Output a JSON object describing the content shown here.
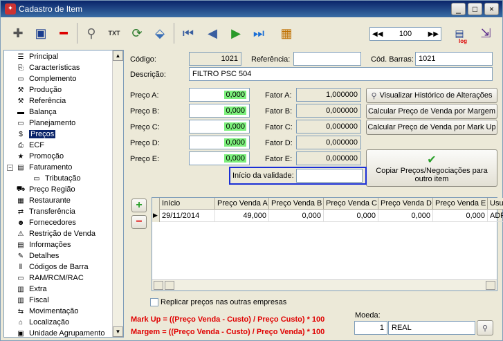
{
  "window": {
    "title": "Cadastro de Item",
    "minimize": "_",
    "maximize": "□",
    "close": "×"
  },
  "toolbar": {
    "nav_first": "◀◀",
    "nav_value": "100",
    "nav_last": "▶▶",
    "buttons": [
      {
        "name": "add-icon",
        "glyph": "✚"
      },
      {
        "name": "save-icon",
        "glyph": "💾"
      },
      {
        "name": "delete-icon",
        "glyph": "━"
      },
      {
        "name": "search-icon",
        "glyph": "🔍"
      },
      {
        "name": "txt-icon",
        "glyph": "TXT"
      },
      {
        "name": "refresh-icon",
        "glyph": "⟳"
      },
      {
        "name": "tag-icon",
        "glyph": "⎙"
      },
      {
        "name": "first-record-icon",
        "glyph": "⏮"
      },
      {
        "name": "prev-record-icon",
        "glyph": "◀"
      },
      {
        "name": "next-record-icon",
        "glyph": "▶"
      },
      {
        "name": "last-record-icon",
        "glyph": "⏭"
      },
      {
        "name": "calendar-icon",
        "glyph": "▦"
      }
    ],
    "log_label": "log"
  },
  "tree": [
    {
      "label": "Principal",
      "icon": "list-icon",
      "glyph": "☰",
      "indent": 1
    },
    {
      "label": "Características",
      "icon": "clip-icon",
      "glyph": "⎘",
      "indent": 1
    },
    {
      "label": "Complemento",
      "icon": "doc-icon",
      "glyph": "▭",
      "indent": 1
    },
    {
      "label": "Produção",
      "icon": "wrench-icon",
      "glyph": "⚒",
      "indent": 1
    },
    {
      "label": "Referência",
      "icon": "wrench-icon",
      "glyph": "⚒",
      "indent": 1
    },
    {
      "label": "Balança",
      "icon": "scale-icon",
      "glyph": "▬",
      "indent": 1
    },
    {
      "label": "Planejamento",
      "icon": "doc-icon",
      "glyph": "▭",
      "indent": 1
    },
    {
      "label": "Preços",
      "icon": "money-icon",
      "glyph": "$",
      "indent": 1,
      "selected": true
    },
    {
      "label": "ECF",
      "icon": "printer-icon",
      "glyph": "⎙",
      "indent": 1
    },
    {
      "label": "Promoção",
      "icon": "star-icon",
      "glyph": "★",
      "indent": 1
    },
    {
      "label": "Faturamento",
      "icon": "invoice-icon",
      "glyph": "▤",
      "indent": 1,
      "expander": "−"
    },
    {
      "label": "Tributação",
      "icon": "tax-icon",
      "glyph": "▭",
      "indent": 2
    },
    {
      "label": "Preço Região",
      "icon": "truck-icon",
      "glyph": "⛟",
      "indent": 1
    },
    {
      "label": "Restaurante",
      "icon": "restaurant-icon",
      "glyph": "▦",
      "indent": 1
    },
    {
      "label": "Transferência",
      "icon": "transfer-icon",
      "glyph": "⇄",
      "indent": 1
    },
    {
      "label": "Fornecedores",
      "icon": "people-icon",
      "glyph": "☻",
      "indent": 1
    },
    {
      "label": "Restrição de Venda",
      "icon": "restriction-icon",
      "glyph": "⚠",
      "indent": 1
    },
    {
      "label": "Informações",
      "icon": "info-icon",
      "glyph": "▤",
      "indent": 1
    },
    {
      "label": "Detalhes",
      "icon": "detail-icon",
      "glyph": "✎",
      "indent": 1
    },
    {
      "label": "Códigos de Barra",
      "icon": "barcode-icon",
      "glyph": "⦀",
      "indent": 1
    },
    {
      "label": "RAM/RCM/RAC",
      "icon": "doc-icon",
      "glyph": "▭",
      "indent": 1
    },
    {
      "label": "Extra",
      "icon": "extra-icon",
      "glyph": "▥",
      "indent": 1
    },
    {
      "label": "Fiscal",
      "icon": "fiscal-icon",
      "glyph": "▥",
      "indent": 1
    },
    {
      "label": "Movimentação",
      "icon": "movement-icon",
      "glyph": "⇆",
      "indent": 1
    },
    {
      "label": "Localização",
      "icon": "location-icon",
      "glyph": "⌂",
      "indent": 1
    },
    {
      "label": "Unidade Agrupamento",
      "icon": "unit-icon",
      "glyph": "▣",
      "indent": 1
    }
  ],
  "form": {
    "codigo_label": "Código:",
    "codigo": "1021",
    "referencia_label": "Referência:",
    "referencia": "",
    "cod_barras_label": "Cód. Barras:",
    "cod_barras": "1021",
    "descricao_label": "Descrição:",
    "descricao": "FILTRO PSC 504",
    "precos": [
      {
        "label": "Preço A:",
        "value": "0,000",
        "fator_label": "Fator A:",
        "fator": "1,000000"
      },
      {
        "label": "Preço B:",
        "value": "0,000",
        "fator_label": "Fator B:",
        "fator": "0,000000"
      },
      {
        "label": "Preço C:",
        "value": "0,000",
        "fator_label": "Fator C:",
        "fator": "0,000000"
      },
      {
        "label": "Preço D:",
        "value": "0,000",
        "fator_label": "Fator D:",
        "fator": "0,000000"
      },
      {
        "label": "Preço E:",
        "value": "0,000",
        "fator_label": "Fator E:",
        "fator": "0,000000"
      }
    ],
    "inicio_validade_label": "Início da validade:",
    "inicio_validade": ""
  },
  "actions": {
    "historico": "Visualizar Histórico de Alterações",
    "calc_margem": "Calcular Preço de Venda por Margem",
    "calc_markup": "Calcular Preço de Venda por Mark Up",
    "copiar": "Copiar Preços/Negociações para outro item",
    "add": "+",
    "remove": "−"
  },
  "grid": {
    "columns": [
      "Início",
      "Preço Venda A",
      "Preço Venda B",
      "Preço Venda C",
      "Preço Venda D",
      "Preço Venda E",
      "Usuá"
    ],
    "rows": [
      [
        "29/11/2014",
        "49,000",
        "0,000",
        "0,000",
        "0,000",
        "0,000",
        "ADR"
      ]
    ]
  },
  "footer": {
    "replicar": "Replicar preços nas outras empresas",
    "markup_formula": "Mark Up = ((Preço Venda - Custo) / Preço Custo) * 100",
    "margem_formula": "Margem = ((Preço Venda - Custo) / Preço Venda) * 100",
    "moeda_label": "Moeda:",
    "moeda_codigo": "1",
    "moeda_nome": "REAL"
  },
  "colors": {
    "highlight_green": "#7cf07c",
    "formula_red": "#e00000",
    "focus_border": "#1a2fd6"
  }
}
